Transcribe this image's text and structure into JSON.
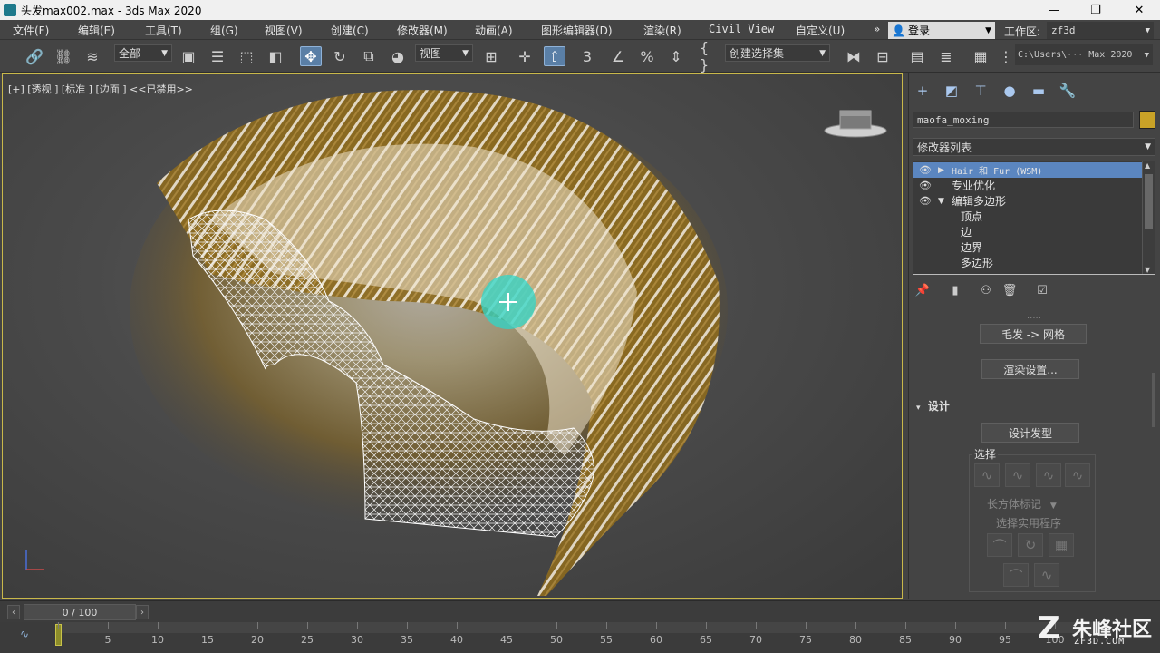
{
  "window": {
    "title": "头发max002.max - 3ds Max 2020",
    "minimize_glyph": "—",
    "maximize_glyph": "❐",
    "close_glyph": "✕"
  },
  "menu": [
    "文件(F)",
    "编辑(E)",
    "工具(T)",
    "组(G)",
    "视图(V)",
    "创建(C)",
    "修改器(M)",
    "动画(A)",
    "图形编辑器(D)",
    "渲染(R)",
    "Civil View",
    "自定义(U)"
  ],
  "menu_overflow": "»",
  "login": {
    "label": "登录",
    "icon": "user-icon"
  },
  "workspace": {
    "label": "工作区:",
    "value": "zf3d"
  },
  "toolbar": {
    "filter_dropdown": "全部",
    "ref_coord_dropdown": "视图",
    "selection_set_dropdown": "创建选择集",
    "path_field": "C:\\Users\\··· Max 2020",
    "snap_label": "3",
    "curly_label": "{ }"
  },
  "viewport": {
    "label": "[+] [透视 ] [标准 ] [边面 ] <<已禁用>>",
    "axis_label": "z"
  },
  "command_panel": {
    "object_name": "maofa_moxing",
    "object_color": "#c9a227",
    "modifier_list": "修改器列表",
    "stack": [
      {
        "label": "Hair 和 Fur (WSM)",
        "selected": true,
        "eye": true,
        "expand": "▶"
      },
      {
        "label": "专业优化",
        "selected": false,
        "eye": true,
        "expand": ""
      },
      {
        "label": "编辑多边形",
        "selected": false,
        "eye": true,
        "expand": "▼"
      },
      {
        "label": "顶点",
        "sub": true
      },
      {
        "label": "边",
        "sub": true
      },
      {
        "label": "边界",
        "sub": true
      },
      {
        "label": "多边形",
        "sub": true
      }
    ],
    "hair_to_mesh_button": "毛发 -> 网格",
    "render_settings_button": "渲染设置...",
    "design_section": "设计",
    "design_hair_button": "设计发型",
    "selection_group": "选择",
    "box_marker_dropdown": "长方体标记",
    "selection_utils_label": "选择实用程序"
  },
  "timeline": {
    "frame_field": "0 / 100",
    "ticks": [
      "0",
      "5",
      "10",
      "15",
      "20",
      "25",
      "30",
      "35",
      "40",
      "45",
      "50",
      "55",
      "60",
      "65",
      "70",
      "75",
      "80",
      "85",
      "90",
      "95",
      "100"
    ]
  },
  "watermark": {
    "logo": "Z",
    "text": "朱峰社区",
    "sub": "ZF3D.COM"
  }
}
